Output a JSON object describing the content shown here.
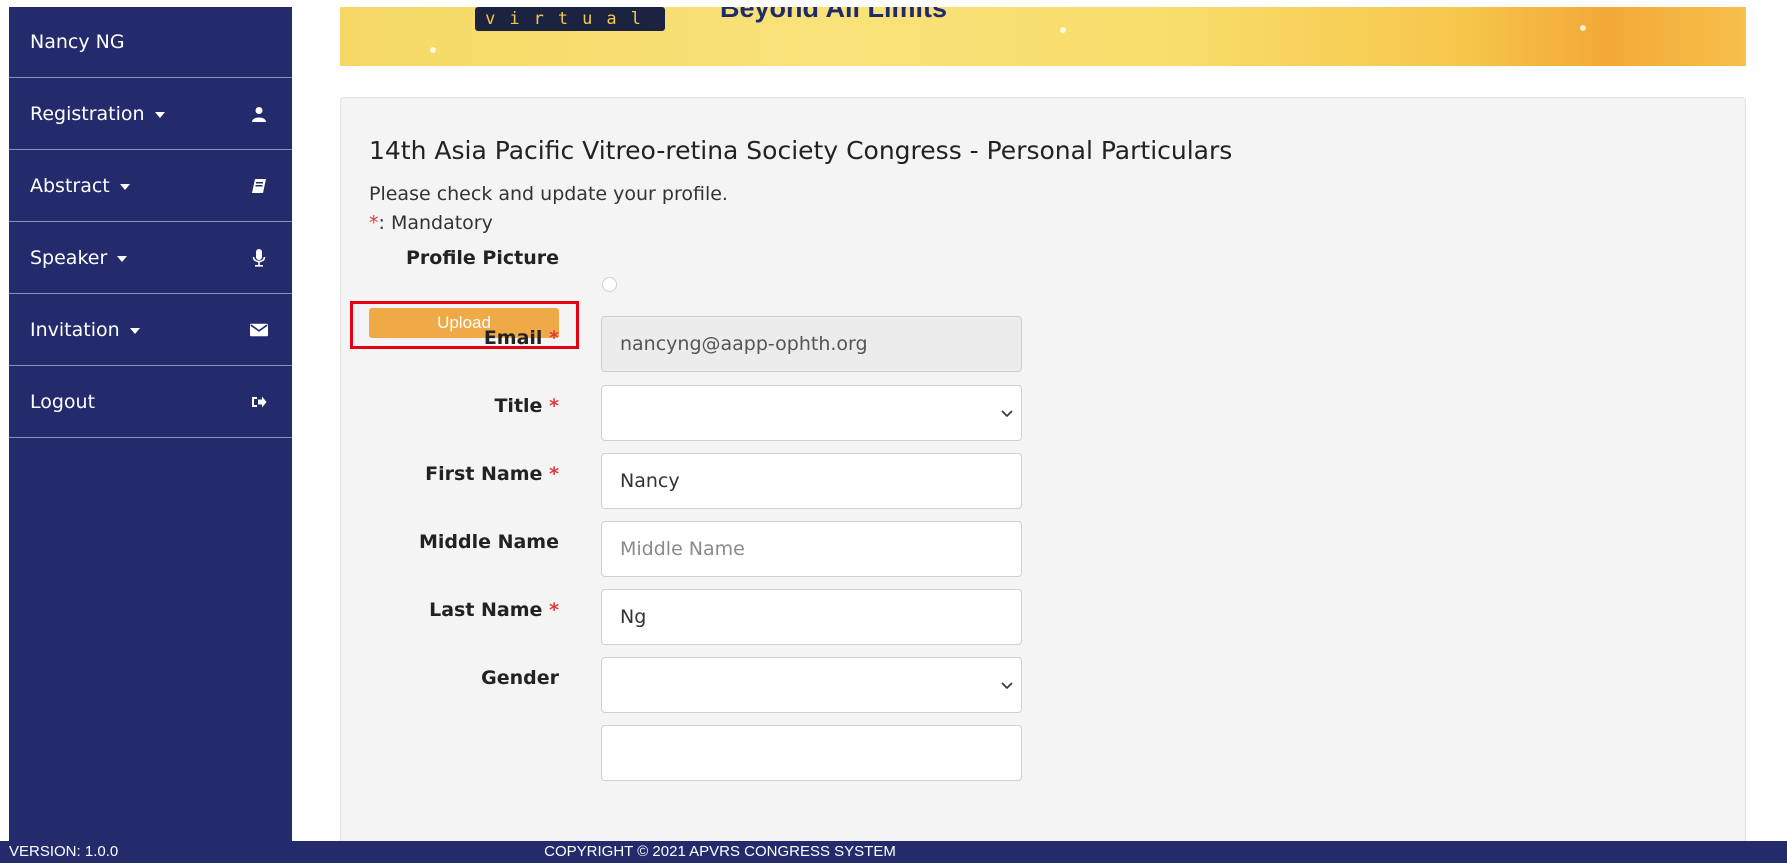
{
  "sidebar": {
    "user_name": "Nancy NG",
    "items": [
      {
        "label": "Registration",
        "icon": "user-icon",
        "has_caret": true
      },
      {
        "label": "Abstract",
        "icon": "book-icon",
        "has_caret": true
      },
      {
        "label": "Speaker",
        "icon": "microphone-icon",
        "has_caret": true
      },
      {
        "label": "Invitation",
        "icon": "envelope-icon",
        "has_caret": true
      },
      {
        "label": "Logout",
        "icon": "sign-out-icon",
        "has_caret": false
      }
    ]
  },
  "banner": {
    "chip_text": "virtual",
    "tagline": "Beyond All Limits"
  },
  "form": {
    "title": "14th Asia Pacific Vitreo-retina Society Congress - Personal Particulars",
    "subtitle": "Please check and update your profile.",
    "mandatory_mark": "*",
    "mandatory_text": ": Mandatory",
    "profile_picture_label": "Profile Picture",
    "upload_label": "Upload",
    "email": {
      "label": "Email",
      "required": "*",
      "value": "nancyng@aapp-ophth.org"
    },
    "title_field": {
      "label": "Title",
      "required": "*",
      "value": ""
    },
    "first_name": {
      "label": "First Name",
      "required": "*",
      "value": "Nancy"
    },
    "middle_name": {
      "label": "Middle Name",
      "placeholder": "Middle Name"
    },
    "last_name": {
      "label": "Last Name",
      "required": "*",
      "value": "Ng"
    },
    "gender": {
      "label": "Gender",
      "value": ""
    }
  },
  "footer": {
    "version": "VERSION: 1.0.0",
    "copyright": "COPYRIGHT © 2021 APVRS CONGRESS SYSTEM"
  },
  "colors": {
    "sidebar_bg": "#232b6c",
    "upload_button": "#efaa47",
    "highlight_border": "#e40012",
    "required_mark": "#e23b3b"
  }
}
